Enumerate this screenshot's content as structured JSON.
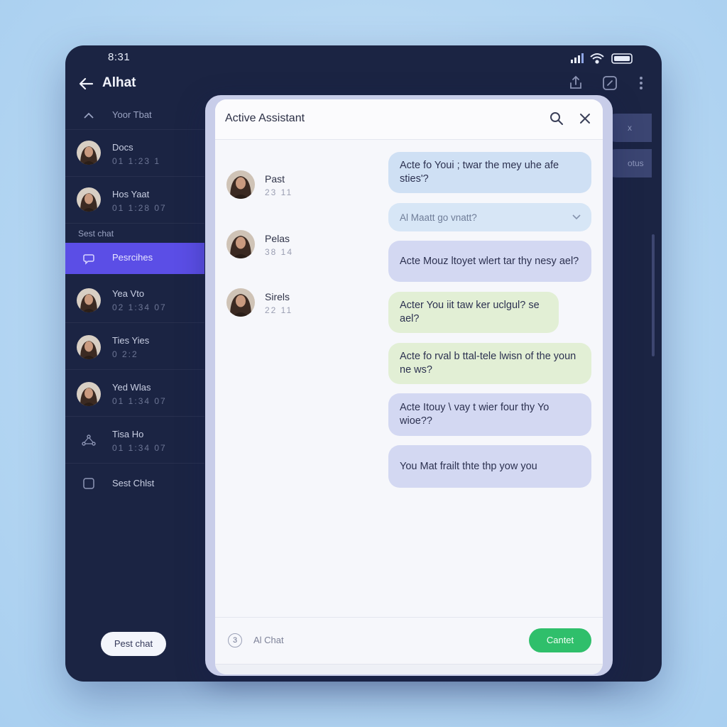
{
  "status": {
    "time": "8:31"
  },
  "header": {
    "title": "Alhat"
  },
  "sidebar": {
    "items": [
      {
        "name": "Yoor Tbat",
        "meta": ""
      },
      {
        "name": "Docs",
        "meta": "01   1:23   1"
      },
      {
        "name": "Hos Yaat",
        "meta": "01   1:28   07"
      },
      {
        "name": "Yea Vto",
        "meta": "02   1:34   07"
      },
      {
        "name": "Ties Yies",
        "meta": "0   2:2"
      },
      {
        "name": "Yed Wlas",
        "meta": "01   1:34   07"
      },
      {
        "name": "Tisa Ho",
        "meta": "01   1:34   07"
      },
      {
        "name": "Sest Chlst",
        "meta": ""
      }
    ],
    "section_label": "Sest chat",
    "active_item": "Pesrcihes",
    "new_chat_button": "Pest chat"
  },
  "right_panel": {
    "pill_1": "x",
    "pill_2": "otus"
  },
  "modal": {
    "title": "Active Assistant",
    "contacts": [
      {
        "name": "Past",
        "meta": "23  11"
      },
      {
        "name": "Pelas",
        "meta": "38  14"
      },
      {
        "name": "Sirels",
        "meta": "22  11"
      }
    ],
    "messages": [
      {
        "text": "Acte fo Youi ; twar the mey uhe afe sties'?",
        "style": "blue"
      },
      {
        "text": "Al Maatt go vnatt?",
        "style": "sugg"
      },
      {
        "text": "Acte Mouz ltoyet wlert tar thy nesy ael?",
        "style": "lilac"
      },
      {
        "text": "Acter You iit taw ker uclgul? se ael?",
        "style": "green"
      },
      {
        "text": "Acte fo rval b ttal-tele lwisn of the youn ne ws?",
        "style": "green"
      },
      {
        "text": "Acte Itouy \\ vay t wier four thy Yo wioe??",
        "style": "lilac"
      },
      {
        "text": "You Mat frailt thte thp yow you",
        "style": "lilac"
      }
    ],
    "footer": {
      "badge": "3",
      "label": "Al Chat",
      "button": "Cantet"
    }
  },
  "colors": {
    "device_bg": "#1b2443",
    "active_item": "#5b4ee6",
    "confirm": "#2fbf6b"
  }
}
